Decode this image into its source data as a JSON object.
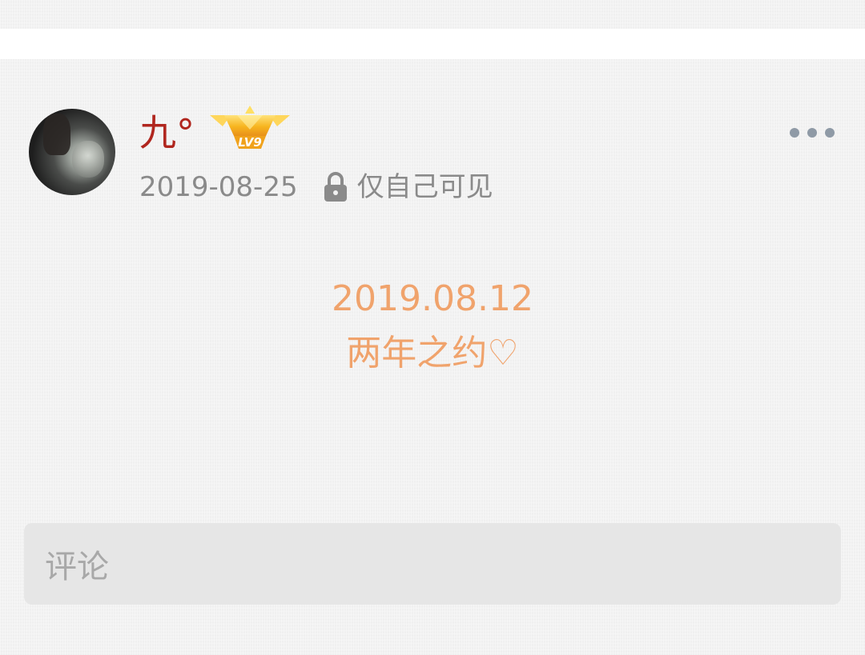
{
  "post": {
    "username": "九°",
    "level_badge": "LV9",
    "date": "2019-08-25",
    "visibility": "仅自己可见",
    "content_lines": [
      "2019.08.12",
      "两年之约♡"
    ]
  },
  "comment": {
    "placeholder": "评论"
  },
  "icons": {
    "lock": "lock-icon",
    "more": "more-icon",
    "badge": "crown-badge-icon"
  },
  "colors": {
    "username": "#b0261e",
    "content": "#f0a36c",
    "meta_text": "#8a8a8a",
    "badge_gold": "#f5b21f"
  }
}
